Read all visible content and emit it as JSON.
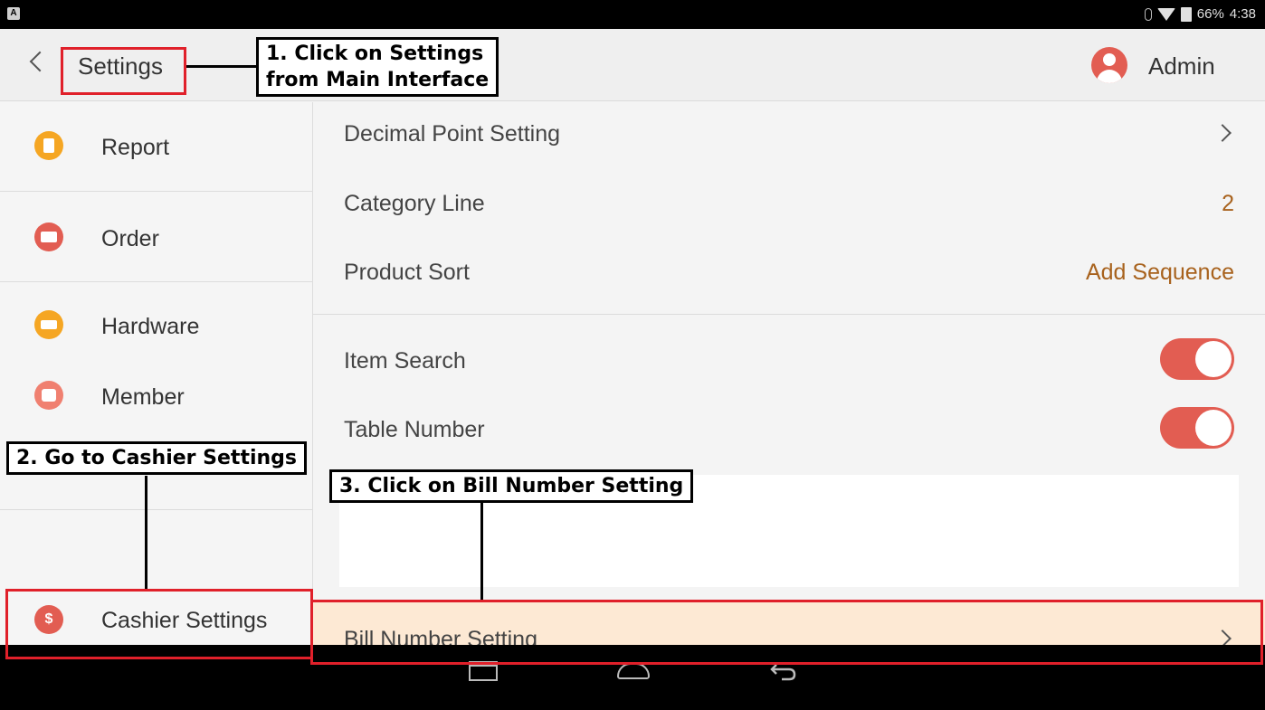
{
  "status_bar": {
    "battery": "66%",
    "time": "4:38",
    "notification_icon": "A"
  },
  "header": {
    "title": "Settings",
    "user": "Admin"
  },
  "sidebar": {
    "items": [
      {
        "label": "Report",
        "icon": "report-icon",
        "color": "#f5a623"
      },
      {
        "label": "Order",
        "icon": "order-icon",
        "color": "#e25d52"
      },
      {
        "label": "Hardware",
        "icon": "printer-icon",
        "color": "#f5a623"
      },
      {
        "label": "Member",
        "icon": "crown-icon",
        "color": "#f08070"
      },
      {
        "label": "Cashier Settings",
        "icon": "dollar-icon",
        "color": "#e25d52",
        "icon_text": "$"
      }
    ]
  },
  "main": {
    "rows": [
      {
        "label": "Decimal Point Setting",
        "type": "chevron"
      },
      {
        "label": "Category Line",
        "value": "2"
      },
      {
        "label": "Product Sort",
        "value": "Add Sequence"
      },
      {
        "label": "Item Search",
        "type": "toggle",
        "on": true
      },
      {
        "label": "Table Number",
        "type": "toggle",
        "on": true
      },
      {
        "label": "Bill Number Setting",
        "type": "chevron"
      }
    ],
    "accent_color": "#a8621d",
    "toggle_color": "#e25d52"
  },
  "annotations": {
    "step1_line1": "1. Click on Settings",
    "step1_line2": "from Main Interface",
    "step2": "2. Go to Cashier Settings",
    "step3": "3. Click on Bill Number Setting",
    "highlight_color": "#e0202a"
  }
}
